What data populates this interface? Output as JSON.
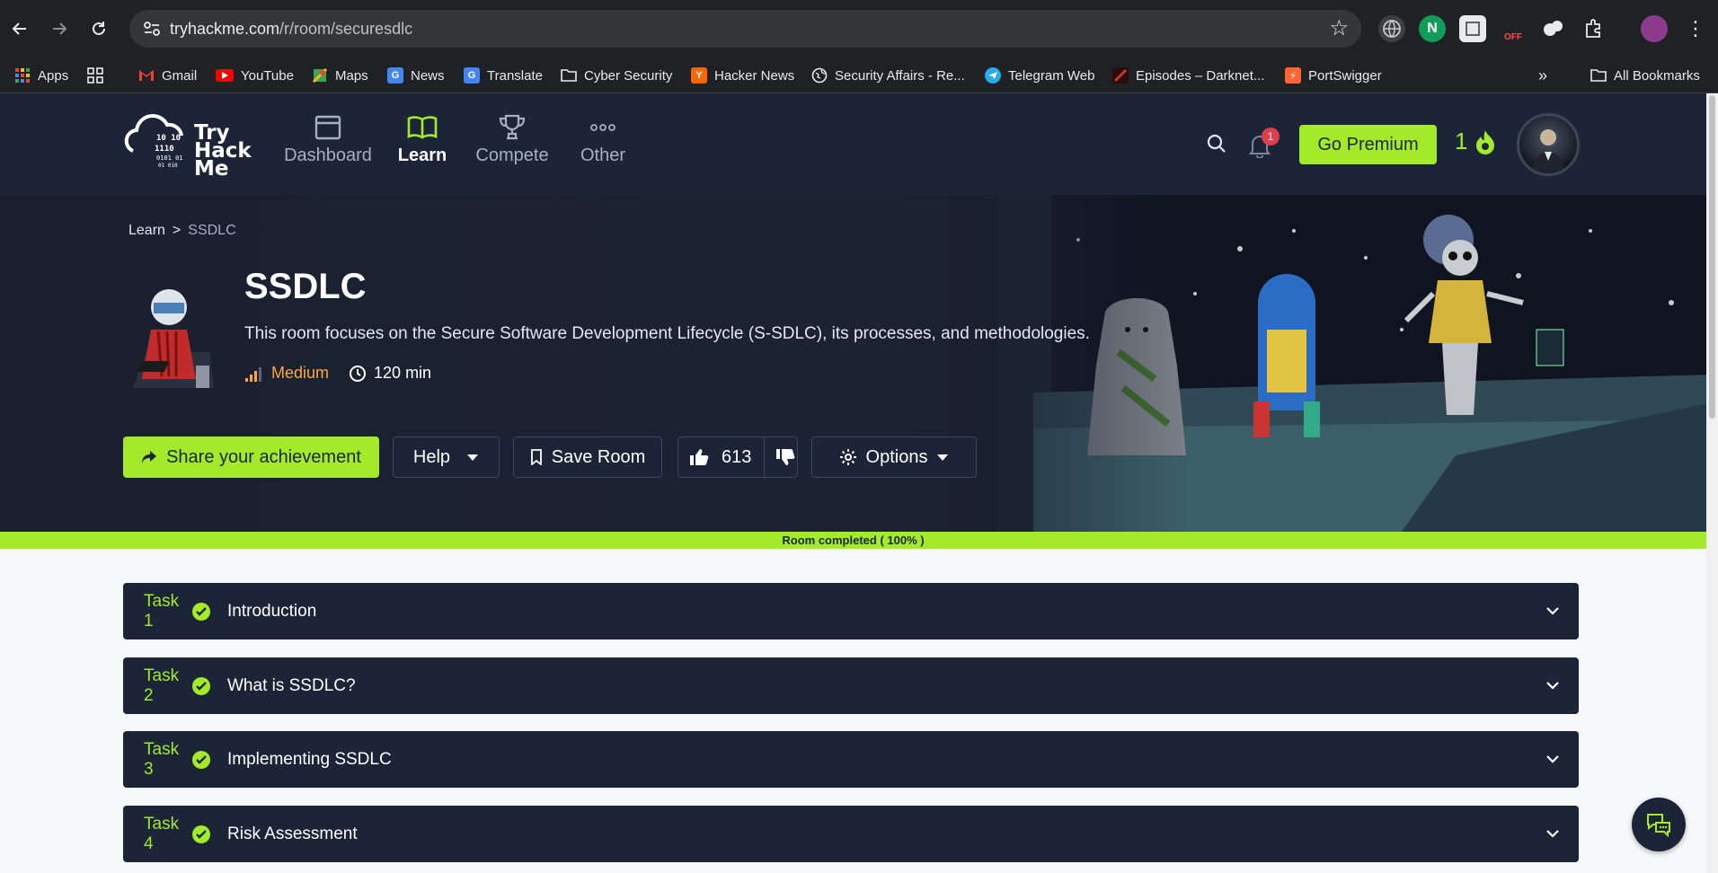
{
  "browser": {
    "url_host": "tryhackme.com",
    "url_path": "/r/room/securesdlc",
    "bookmarks": [
      {
        "label": "Apps",
        "icon": "apps-grid-icon",
        "color": "#ea4335"
      },
      {
        "label": "Gmail",
        "icon": "gmail-icon",
        "color": "#ea4335"
      },
      {
        "label": "YouTube",
        "icon": "youtube-icon",
        "color": "#ff0000"
      },
      {
        "label": "Maps",
        "icon": "maps-icon",
        "color": "#34a853"
      },
      {
        "label": "News",
        "icon": "news-icon",
        "color": "#4285f4"
      },
      {
        "label": "Translate",
        "icon": "translate-icon",
        "color": "#4285f4"
      },
      {
        "label": "Cyber Security",
        "icon": "folder-icon",
        "color": ""
      },
      {
        "label": "Hacker News",
        "icon": "hacker-news-icon",
        "color": "#ff6600"
      },
      {
        "label": "Security Affairs - Re...",
        "icon": "globe-icon",
        "color": ""
      },
      {
        "label": "Telegram Web",
        "icon": "telegram-icon",
        "color": "#2aabee"
      },
      {
        "label": "Episodes – Darknet...",
        "icon": "darknet-icon",
        "color": "#c0392b"
      },
      {
        "label": "PortSwigger",
        "icon": "portswigger-icon",
        "color": "#ff6633"
      }
    ],
    "all_bookmarks": "All Bookmarks",
    "overflow": "»"
  },
  "header": {
    "logo_line1": "Try",
    "logo_line2": "Hack",
    "logo_line3": "Me",
    "nav": [
      {
        "label": "Dashboard",
        "icon": "dashboard-icon"
      },
      {
        "label": "Learn",
        "icon": "book-icon",
        "active": true
      },
      {
        "label": "Compete",
        "icon": "trophy-icon"
      },
      {
        "label": "Other",
        "icon": "more-dots-icon"
      }
    ],
    "notification_count": "1",
    "premium_label": "Go Premium",
    "streak": "1"
  },
  "room": {
    "breadcrumb_root": "Learn",
    "breadcrumb_sep": ">",
    "breadcrumb_current": "SSDLC",
    "title": "SSDLC",
    "description": "This room focuses on the Secure Software Development Lifecycle (S-SDLC), its processes, and methodologies.",
    "difficulty": "Medium",
    "duration": "120 min",
    "share_label": "Share your achievement",
    "help_label": "Help",
    "save_label": "Save Room",
    "likes": "613",
    "options_label": "Options",
    "progress_text": "Room completed ( 100% )",
    "progress_fraction": 1.0
  },
  "tasks": [
    {
      "num": "Task 1",
      "name": "Introduction"
    },
    {
      "num": "Task 2",
      "name": "What is SSDLC?"
    },
    {
      "num": "Task 3",
      "name": "Implementing SSDLC"
    },
    {
      "num": "Task 4",
      "name": "Risk Assessment"
    }
  ],
  "colors": {
    "accent": "#a3ea2a",
    "header_bg": "#1c2538",
    "difficulty_medium": "#ffa63c"
  }
}
